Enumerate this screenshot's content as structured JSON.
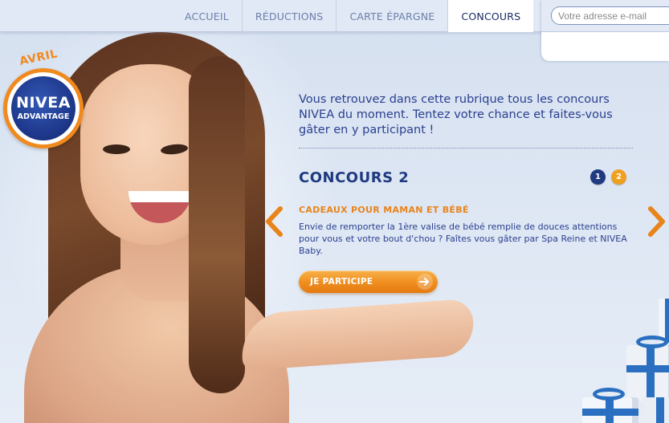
{
  "nav": {
    "items": [
      {
        "label": "ACCUEIL"
      },
      {
        "label": "RÉDUCTIONS"
      },
      {
        "label": "CARTE ÉPARGNE"
      },
      {
        "label": "CONCOURS"
      }
    ],
    "active_index": 3
  },
  "newsletter": {
    "placeholder": "Votre adresse e-mail"
  },
  "logo": {
    "brand": "NIVEA",
    "program": "ADVANTAGE",
    "month": "AVRIL"
  },
  "intro": {
    "text": "Vous retrouvez dans cette rubrique tous les concours NIVEA du moment. Tentez votre chance et faites-vous gâter en y participant  !"
  },
  "contest": {
    "title": "CONCOURS 2",
    "subtitle": "CADEAUX POUR MAMAN ET BÉBÉ",
    "description": "Envie de remporter la 1ère valise de bébé remplie de douces attentions pour vous et votre bout d'chou ? Faîtes vous gâter par Spa Reine et NIVEA Baby.",
    "cta_label": "JE PARTICIPE",
    "pages": [
      "1",
      "2"
    ],
    "current_page": 2
  },
  "colors": {
    "brand_blue": "#1f3a80",
    "accent_orange": "#ef8d1e",
    "text_blue": "#2a3f8f"
  }
}
